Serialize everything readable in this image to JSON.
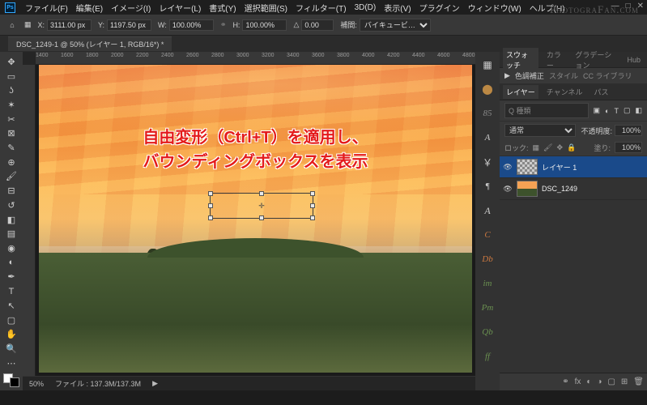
{
  "watermark": "PhotograFan.com",
  "menu": [
    "ファイル(F)",
    "編集(E)",
    "イメージ(I)",
    "レイヤー(L)",
    "書式(Y)",
    "選択範囲(S)",
    "フィルター(T)",
    "3D(D)",
    "表示(V)",
    "プラグイン",
    "ウィンドウ(W)",
    "ヘルプ(H)"
  ],
  "opts": {
    "x_lbl": "X:",
    "x_val": "3111.00 px",
    "y_lbl": "Y:",
    "y_val": "1197.50 px",
    "w_lbl": "W:",
    "w_val": "100.00%",
    "h_lbl": "H:",
    "h_val": "100.00%",
    "a_lbl": "△",
    "a_val": "0.00",
    "interp_lbl": "補間:",
    "interp_val": "バイキュービ…"
  },
  "doc_tab": "DSC_1249-1 @ 50% (レイヤー 1, RGB/16*) *",
  "ruler_h": [
    "1400",
    "1600",
    "1800",
    "2000",
    "2200",
    "2400",
    "2600",
    "2800",
    "3000",
    "3200",
    "3400",
    "3600",
    "3800",
    "4000",
    "4200",
    "4400",
    "4600",
    "4800"
  ],
  "annot_l1": "自由変形（Ctrl+T）を適用し、",
  "annot_l2": "バウンディングボックスを表示",
  "status": {
    "zoom": "50%",
    "file": "ファイル : 137.3M/137.3M"
  },
  "pstrip": [
    "85",
    "A",
    "￥",
    "¶",
    "A",
    "C",
    "Db",
    "im",
    "Pm",
    "Qb",
    "ff"
  ],
  "panel_top": {
    "tabs": [
      "スウォッチ",
      "カラー",
      "グラデーション",
      "Hub"
    ],
    "row": [
      "色調補正",
      "スタイル",
      "CC ライブラリ"
    ]
  },
  "layers": {
    "tabs": [
      "レイヤー",
      "チャンネル",
      "パス"
    ],
    "search_ph": "Q 種類",
    "blend": "通常",
    "opacity_lbl": "不透明度:",
    "opacity": "100%",
    "lock_lbl": "ロック:",
    "fill_lbl": "塗り:",
    "fill": "100%",
    "items": [
      {
        "name": "レイヤー 1",
        "sel": true,
        "thumb": "trans"
      },
      {
        "name": "DSC_1249",
        "sel": false,
        "thumb": "img"
      }
    ]
  }
}
